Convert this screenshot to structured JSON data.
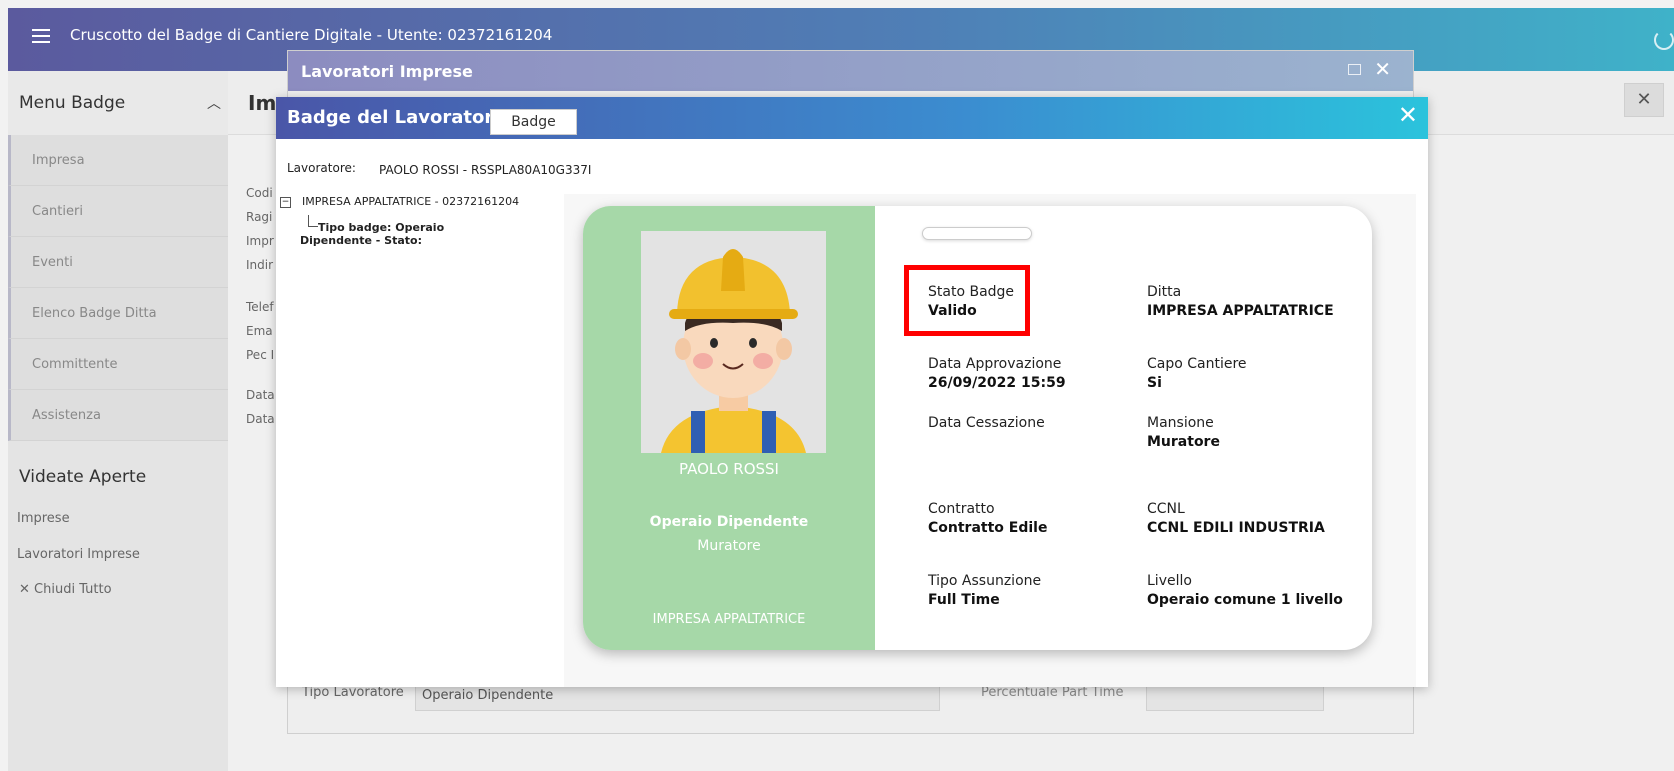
{
  "header": {
    "title": "Cruscotto del Badge di Cantiere Digitale - Utente: 02372161204"
  },
  "sidebar": {
    "menu_title": "Menu Badge",
    "items": [
      {
        "label": "Impresa"
      },
      {
        "label": "Cantieri"
      },
      {
        "label": "Eventi"
      },
      {
        "label": "Elenco Badge Ditta"
      },
      {
        "label": "Committente"
      },
      {
        "label": "Assistenza"
      }
    ],
    "videate_title": "Videate Aperte",
    "videate": [
      {
        "label": "Imprese"
      },
      {
        "label": "Lavoratori Imprese"
      }
    ],
    "close_all": "Chiudi Tutto"
  },
  "main": {
    "title": "Im",
    "labels": [
      "Codi",
      "Ragi",
      "Impr",
      "Indir",
      "Telef",
      "Ema",
      "Pec I",
      "Data",
      "Data"
    ]
  },
  "lavoratori_window": {
    "title": "Lavoratori Imprese",
    "tipo_lavoratore_label": "Tipo Lavoratore",
    "tipo_lavoratore_value": "Operaio Dipendente",
    "part_time_label": "Percentuale Part Time"
  },
  "modal": {
    "title": "Badge del Lavoratore",
    "tab": "Badge",
    "lavoratore_label": "Lavoratore:",
    "lavoratore_value": "PAOLO ROSSI - RSSPLA80A10G337I",
    "tree_root": "IMPRESA APPALTATRICE - 02372161204",
    "tree_child": "Tipo badge: Operaio Dipendente - Stato:"
  },
  "card": {
    "name": "PAOLO ROSSI",
    "role": "Operaio Dipendente",
    "mansione": "Muratore",
    "company": "IMPRESA APPALTATRICE",
    "fields": {
      "stato_badge": {
        "label": "Stato Badge",
        "value": "Valido"
      },
      "ditta": {
        "label": "Ditta",
        "value": "IMPRESA APPALTATRICE"
      },
      "data_approvazione": {
        "label": "Data Approvazione",
        "value": "26/09/2022 15:59"
      },
      "capo_cantiere": {
        "label": "Capo Cantiere",
        "value": "Si"
      },
      "data_cessazione": {
        "label": "Data Cessazione",
        "value": ""
      },
      "mansione": {
        "label": "Mansione",
        "value": "Muratore"
      },
      "contratto": {
        "label": "Contratto",
        "value": "Contratto Edile"
      },
      "ccnl": {
        "label": "CCNL",
        "value": "CCNL EDILI INDUSTRIA"
      },
      "tipo_assunzione": {
        "label": "Tipo Assunzione",
        "value": "Full Time"
      },
      "livello": {
        "label": "Livello",
        "value": "Operaio comune 1 livello"
      }
    }
  },
  "colors": {
    "card_left": "#a6d8a8",
    "highlight": "#ff0000",
    "header_gradient_start": "#5b5a9e",
    "header_gradient_end": "#3fb2c9"
  },
  "icons": {
    "menu": "hamburger-icon",
    "power": "power-icon",
    "collapse": "chevron-up-icon",
    "close": "close-icon",
    "maximize": "maximize-icon"
  }
}
